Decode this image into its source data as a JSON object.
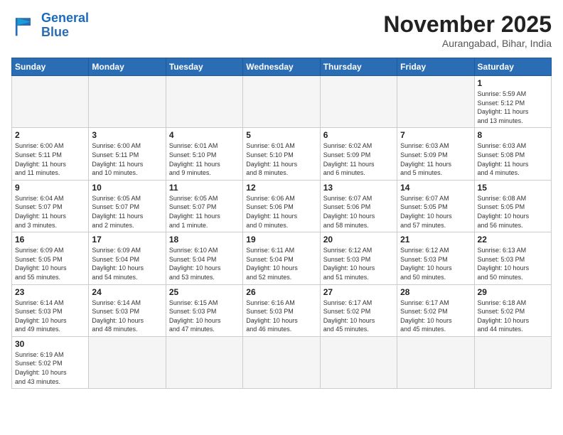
{
  "logo": {
    "line1": "General",
    "line2": "Blue"
  },
  "title": "November 2025",
  "subtitle": "Aurangabad, Bihar, India",
  "weekdays": [
    "Sunday",
    "Monday",
    "Tuesday",
    "Wednesday",
    "Thursday",
    "Friday",
    "Saturday"
  ],
  "days": [
    {
      "num": "",
      "info": ""
    },
    {
      "num": "",
      "info": ""
    },
    {
      "num": "",
      "info": ""
    },
    {
      "num": "",
      "info": ""
    },
    {
      "num": "",
      "info": ""
    },
    {
      "num": "",
      "info": ""
    },
    {
      "num": "1",
      "info": "Sunrise: 5:59 AM\nSunset: 5:12 PM\nDaylight: 11 hours\nand 13 minutes."
    },
    {
      "num": "2",
      "info": "Sunrise: 6:00 AM\nSunset: 5:11 PM\nDaylight: 11 hours\nand 11 minutes."
    },
    {
      "num": "3",
      "info": "Sunrise: 6:00 AM\nSunset: 5:11 PM\nDaylight: 11 hours\nand 10 minutes."
    },
    {
      "num": "4",
      "info": "Sunrise: 6:01 AM\nSunset: 5:10 PM\nDaylight: 11 hours\nand 9 minutes."
    },
    {
      "num": "5",
      "info": "Sunrise: 6:01 AM\nSunset: 5:10 PM\nDaylight: 11 hours\nand 8 minutes."
    },
    {
      "num": "6",
      "info": "Sunrise: 6:02 AM\nSunset: 5:09 PM\nDaylight: 11 hours\nand 6 minutes."
    },
    {
      "num": "7",
      "info": "Sunrise: 6:03 AM\nSunset: 5:09 PM\nDaylight: 11 hours\nand 5 minutes."
    },
    {
      "num": "8",
      "info": "Sunrise: 6:03 AM\nSunset: 5:08 PM\nDaylight: 11 hours\nand 4 minutes."
    },
    {
      "num": "9",
      "info": "Sunrise: 6:04 AM\nSunset: 5:07 PM\nDaylight: 11 hours\nand 3 minutes."
    },
    {
      "num": "10",
      "info": "Sunrise: 6:05 AM\nSunset: 5:07 PM\nDaylight: 11 hours\nand 2 minutes."
    },
    {
      "num": "11",
      "info": "Sunrise: 6:05 AM\nSunset: 5:07 PM\nDaylight: 11 hours\nand 1 minute."
    },
    {
      "num": "12",
      "info": "Sunrise: 6:06 AM\nSunset: 5:06 PM\nDaylight: 11 hours\nand 0 minutes."
    },
    {
      "num": "13",
      "info": "Sunrise: 6:07 AM\nSunset: 5:06 PM\nDaylight: 10 hours\nand 58 minutes."
    },
    {
      "num": "14",
      "info": "Sunrise: 6:07 AM\nSunset: 5:05 PM\nDaylight: 10 hours\nand 57 minutes."
    },
    {
      "num": "15",
      "info": "Sunrise: 6:08 AM\nSunset: 5:05 PM\nDaylight: 10 hours\nand 56 minutes."
    },
    {
      "num": "16",
      "info": "Sunrise: 6:09 AM\nSunset: 5:05 PM\nDaylight: 10 hours\nand 55 minutes."
    },
    {
      "num": "17",
      "info": "Sunrise: 6:09 AM\nSunset: 5:04 PM\nDaylight: 10 hours\nand 54 minutes."
    },
    {
      "num": "18",
      "info": "Sunrise: 6:10 AM\nSunset: 5:04 PM\nDaylight: 10 hours\nand 53 minutes."
    },
    {
      "num": "19",
      "info": "Sunrise: 6:11 AM\nSunset: 5:04 PM\nDaylight: 10 hours\nand 52 minutes."
    },
    {
      "num": "20",
      "info": "Sunrise: 6:12 AM\nSunset: 5:03 PM\nDaylight: 10 hours\nand 51 minutes."
    },
    {
      "num": "21",
      "info": "Sunrise: 6:12 AM\nSunset: 5:03 PM\nDaylight: 10 hours\nand 50 minutes."
    },
    {
      "num": "22",
      "info": "Sunrise: 6:13 AM\nSunset: 5:03 PM\nDaylight: 10 hours\nand 50 minutes."
    },
    {
      "num": "23",
      "info": "Sunrise: 6:14 AM\nSunset: 5:03 PM\nDaylight: 10 hours\nand 49 minutes."
    },
    {
      "num": "24",
      "info": "Sunrise: 6:14 AM\nSunset: 5:03 PM\nDaylight: 10 hours\nand 48 minutes."
    },
    {
      "num": "25",
      "info": "Sunrise: 6:15 AM\nSunset: 5:03 PM\nDaylight: 10 hours\nand 47 minutes."
    },
    {
      "num": "26",
      "info": "Sunrise: 6:16 AM\nSunset: 5:03 PM\nDaylight: 10 hours\nand 46 minutes."
    },
    {
      "num": "27",
      "info": "Sunrise: 6:17 AM\nSunset: 5:02 PM\nDaylight: 10 hours\nand 45 minutes."
    },
    {
      "num": "28",
      "info": "Sunrise: 6:17 AM\nSunset: 5:02 PM\nDaylight: 10 hours\nand 45 minutes."
    },
    {
      "num": "29",
      "info": "Sunrise: 6:18 AM\nSunset: 5:02 PM\nDaylight: 10 hours\nand 44 minutes."
    },
    {
      "num": "30",
      "info": "Sunrise: 6:19 AM\nSunset: 5:02 PM\nDaylight: 10 hours\nand 43 minutes."
    },
    {
      "num": "",
      "info": ""
    },
    {
      "num": "",
      "info": ""
    },
    {
      "num": "",
      "info": ""
    },
    {
      "num": "",
      "info": ""
    },
    {
      "num": "",
      "info": ""
    },
    {
      "num": "",
      "info": ""
    }
  ]
}
